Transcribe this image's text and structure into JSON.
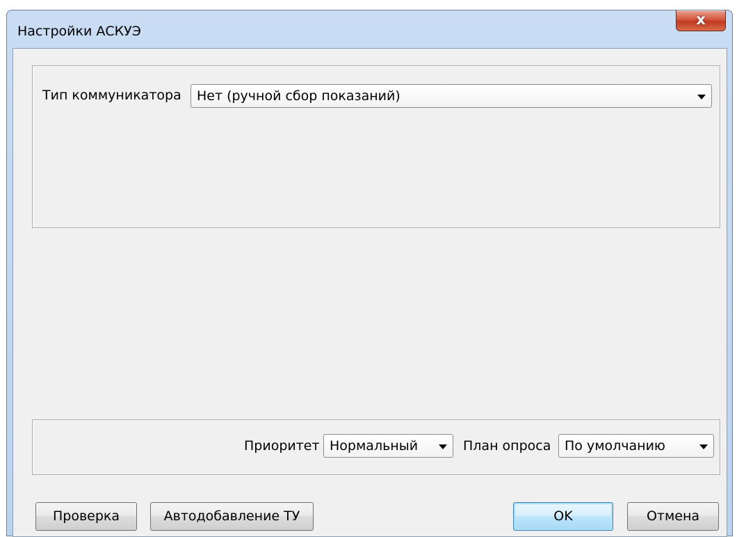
{
  "window": {
    "title": "Настройки АСКУЭ",
    "close_label": "x"
  },
  "communicator": {
    "label": "Тип коммуникатора",
    "value": "Нет (ручной сбор показаний)"
  },
  "polling": {
    "priority_label": "Приоритет",
    "priority_value": "Нормальный",
    "plan_label": "План опроса",
    "plan_value": "По умолчанию"
  },
  "buttons": {
    "check": "Проверка",
    "autoadd": "Автодобавление ТУ",
    "ok": "OK",
    "cancel": "Отмена"
  }
}
